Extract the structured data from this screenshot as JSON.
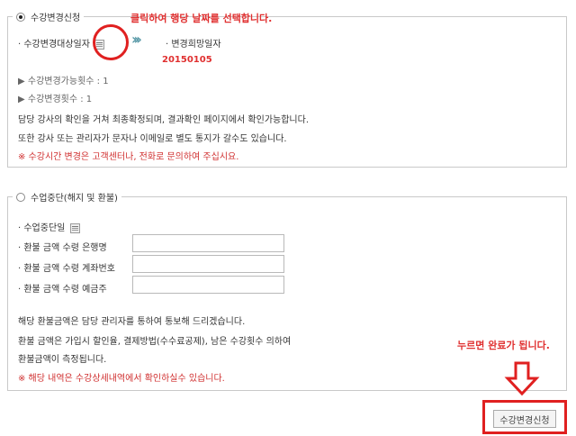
{
  "section1": {
    "legend": "수강변경신청",
    "row1_label": "· 수강변경대상일자",
    "arrow_glyph": "›››",
    "row1_right_label": "· 변경희망일자",
    "date_value": "20150105",
    "count_available": "▶ 수강변경가능횟수 : 1",
    "count_changed": "▶ 수강변경횟수 : 1",
    "desc1": "담당 강사의 확인을 거쳐 최종확정되며, 결과확인 페이지에서 확인가능합니다.",
    "desc2": "또한 강사 또는 관리자가 문자나 이메일로 별도 통지가 갈수도 있습니다.",
    "notice": "※ 수강시간 변경은 고객센터나, 전화로 문의하여 주십시요."
  },
  "section2": {
    "legend": "수업중단(해지 및 환불)",
    "stop_date_label": "· 수업중단일",
    "bank_label": "· 환불 금액 수령 은행명",
    "account_label": "· 환불 금액 수령 계좌번호",
    "holder_label": "· 환불 금액 수령 예금주",
    "bank_value": "",
    "account_value": "",
    "holder_value": "",
    "desc1": "해당 환불금액은 담당 관리자를 통하여 통보해 드리겠습니다.",
    "desc2": "환불 금액은 가입시 할인율, 결제방법(수수료공제), 남은 수강횟수 의하여",
    "desc3": "환불금액이 측정됩니다.",
    "notice": "※ 해당 내역은 수강상세내역에서 확인하실수 있습니다."
  },
  "annotations": {
    "click_hint": "클릭하여 행당 날짜를 선택합니다.",
    "press_hint": "누르면 완료가 됩니다.",
    "arrow_down_glyph": "⇩"
  },
  "submit_button": "수강변경신청",
  "colors": {
    "annotation_red": "#e02020",
    "notice_red": "#d03030",
    "chevron": "#5a9aa8"
  }
}
